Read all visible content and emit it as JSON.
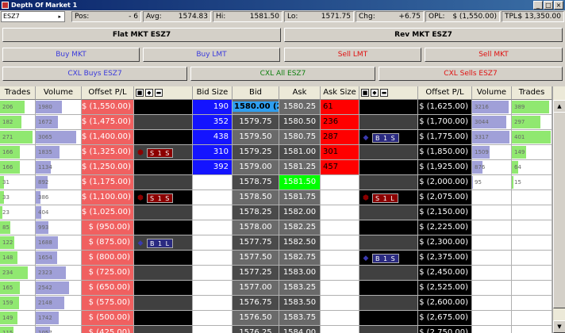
{
  "window": {
    "title": "Depth Of Market 1"
  },
  "status": {
    "symbol": "ESZ7",
    "pos_label": "Pos:",
    "pos": "- 6",
    "avg_label": "Avg:",
    "avg": "1574.83",
    "hi_label": "Hi:",
    "hi": "1581.50",
    "lo_label": "Lo:",
    "lo": "1571.75",
    "chg_label": "Chg:",
    "chg": "+6.75",
    "opl_label": "OPL:",
    "opl": "$ (1,550.00)",
    "tpl_label": "TPL:",
    "tpl": "$ 13,350.00"
  },
  "buttons": {
    "flat": "Flat MKT ESZ7",
    "rev": "Rev MKT ESZ7",
    "buy_mkt": "Buy MKT",
    "buy_lmt": "Buy LMT",
    "sell_lmt": "Sell LMT",
    "sell_mkt": "Sell MKT",
    "cxl_buys": "CXL Buys ESZ7",
    "cxl_all": "CXL All ESZ7",
    "cxl_sells": "CXL Sells ESZ7"
  },
  "colors": {
    "buy_text": "#3a3adc",
    "sell_text": "#e01010",
    "cxl_all_text": "#108010",
    "bid_blue": "#1414ff",
    "ask_red": "#ff0000",
    "last_green": "#00ff00",
    "pl_red": "#f06060",
    "buy_bar": "#a0a0d8",
    "trades_bar": "#90e870"
  },
  "headers": {
    "trades_l": "Trades",
    "volume_l": "Volume",
    "offset_l": "Offset P/L",
    "bid_size": "Bid Size",
    "bid": "Bid",
    "ask": "Ask",
    "ask_size": "Ask Size",
    "offset_r": "Offset P/L",
    "volume_r": "Volume",
    "trades_r": "Trades"
  },
  "rows": [
    {
      "trades_l": "206",
      "volume_l": "1980",
      "offset_l": "$ (1,550.00)",
      "buy_order": "",
      "bid_size": "190",
      "bid": "1580.00 (2)",
      "ask": "1580.25",
      "ask_size": "61",
      "sell_order": "",
      "offset_r": "$ (1,625.00)",
      "volume_r": "3216",
      "trades_r": "389"
    },
    {
      "trades_l": "182",
      "volume_l": "1672",
      "offset_l": "$ (1,475.00)",
      "buy_order": "",
      "bid_size": "352",
      "bid": "1579.75",
      "ask": "1580.50",
      "ask_size": "236",
      "sell_order": "",
      "offset_r": "$ (1,700.00)",
      "volume_r": "3044",
      "trades_r": "297"
    },
    {
      "trades_l": "271",
      "volume_l": "3065",
      "offset_l": "$ (1,400.00)",
      "buy_order": "",
      "bid_size": "438",
      "bid": "1579.50",
      "ask": "1580.75",
      "ask_size": "287",
      "sell_order": "B 1 S",
      "offset_r": "$ (1,775.00)",
      "volume_r": "3317",
      "trades_r": "401"
    },
    {
      "trades_l": "166",
      "volume_l": "1835",
      "offset_l": "$ (1,325.00)",
      "buy_order": "S 1 S",
      "bid_size": "310",
      "bid": "1579.25",
      "ask": "1581.00",
      "ask_size": "301",
      "sell_order": "",
      "offset_r": "$ (1,850.00)",
      "volume_r": "1509",
      "trades_r": "149"
    },
    {
      "trades_l": "166",
      "volume_l": "1134",
      "offset_l": "$ (1,250.00)",
      "buy_order": "",
      "bid_size": "392",
      "bid": "1579.00",
      "ask": "1581.25",
      "ask_size": "457",
      "sell_order": "",
      "offset_r": "$ (1,925.00)",
      "volume_r": "876",
      "trades_r": "64"
    },
    {
      "trades_l": "31",
      "volume_l": "892",
      "offset_l": "$ (1,175.00)",
      "buy_order": "",
      "bid_size": "",
      "bid": "1578.75",
      "ask": "1581.50",
      "ask_size": "",
      "sell_order": "",
      "offset_r": "$ (2,000.00)",
      "volume_r": "95",
      "trades_r": "15"
    },
    {
      "trades_l": "33",
      "volume_l": "386",
      "offset_l": "$ (1,100.00)",
      "buy_order": "S 1 S",
      "bid_size": "",
      "bid": "1578.50",
      "ask": "1581.75",
      "ask_size": "",
      "sell_order": "S 1 L",
      "offset_r": "$ (2,075.00)",
      "volume_r": "",
      "trades_r": ""
    },
    {
      "trades_l": "23",
      "volume_l": "404",
      "offset_l": "$ (1,025.00)",
      "buy_order": "",
      "bid_size": "",
      "bid": "1578.25",
      "ask": "1582.00",
      "ask_size": "",
      "sell_order": "",
      "offset_r": "$ (2,150.00)",
      "volume_r": "",
      "trades_r": ""
    },
    {
      "trades_l": "85",
      "volume_l": "993",
      "offset_l": "$ (950.00)",
      "buy_order": "",
      "bid_size": "",
      "bid": "1578.00",
      "ask": "1582.25",
      "ask_size": "",
      "sell_order": "",
      "offset_r": "$ (2,225.00)",
      "volume_r": "",
      "trades_r": ""
    },
    {
      "trades_l": "122",
      "volume_l": "1688",
      "offset_l": "$ (875.00)",
      "buy_order": "B 1 L",
      "bid_size": "",
      "bid": "1577.75",
      "ask": "1582.50",
      "ask_size": "",
      "sell_order": "",
      "offset_r": "$ (2,300.00)",
      "volume_r": "",
      "trades_r": ""
    },
    {
      "trades_l": "148",
      "volume_l": "1654",
      "offset_l": "$ (800.00)",
      "buy_order": "",
      "bid_size": "",
      "bid": "1577.50",
      "ask": "1582.75",
      "ask_size": "",
      "sell_order": "B 1 S",
      "offset_r": "$ (2,375.00)",
      "volume_r": "",
      "trades_r": ""
    },
    {
      "trades_l": "234",
      "volume_l": "2323",
      "offset_l": "$ (725.00)",
      "buy_order": "",
      "bid_size": "",
      "bid": "1577.25",
      "ask": "1583.00",
      "ask_size": "",
      "sell_order": "",
      "offset_r": "$ (2,450.00)",
      "volume_r": "",
      "trades_r": ""
    },
    {
      "trades_l": "165",
      "volume_l": "2542",
      "offset_l": "$ (650.00)",
      "buy_order": "",
      "bid_size": "",
      "bid": "1577.00",
      "ask": "1583.25",
      "ask_size": "",
      "sell_order": "",
      "offset_r": "$ (2,525.00)",
      "volume_r": "",
      "trades_r": ""
    },
    {
      "trades_l": "159",
      "volume_l": "2148",
      "offset_l": "$ (575.00)",
      "buy_order": "",
      "bid_size": "",
      "bid": "1576.75",
      "ask": "1583.50",
      "ask_size": "",
      "sell_order": "",
      "offset_r": "$ (2,600.00)",
      "volume_r": "",
      "trades_r": ""
    },
    {
      "trades_l": "149",
      "volume_l": "1742",
      "offset_l": "$ (500.00)",
      "buy_order": "",
      "bid_size": "",
      "bid": "1576.50",
      "ask": "1583.75",
      "ask_size": "",
      "sell_order": "",
      "offset_r": "$ (2,675.00)",
      "volume_r": "",
      "trades_r": ""
    },
    {
      "trades_l": "115",
      "volume_l": "1057",
      "offset_l": "$ (425.00)",
      "buy_order": "",
      "bid_size": "",
      "bid": "1576.25",
      "ask": "1584.00",
      "ask_size": "",
      "sell_order": "",
      "offset_r": "$ (2,750.00)",
      "volume_r": "",
      "trades_r": ""
    }
  ],
  "last_trade": "1581.50"
}
